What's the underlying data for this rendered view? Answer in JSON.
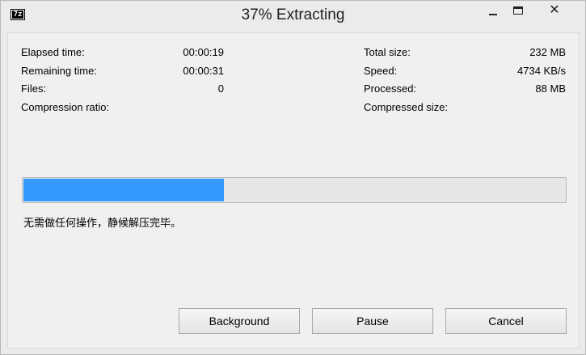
{
  "window": {
    "title": "37% Extracting",
    "app_icon_text": "7z"
  },
  "stats_left": [
    {
      "label": "Elapsed time:",
      "value": "00:00:19"
    },
    {
      "label": "Remaining time:",
      "value": "00:00:31"
    },
    {
      "label": "Files:",
      "value": "0"
    },
    {
      "label": "Compression ratio:",
      "value": ""
    }
  ],
  "stats_right": [
    {
      "label": "Total size:",
      "value": "232 MB"
    },
    {
      "label": "Speed:",
      "value": "4734 KB/s"
    },
    {
      "label": "Processed:",
      "value": "88 MB"
    },
    {
      "label": "Compressed size:",
      "value": ""
    }
  ],
  "progress": {
    "fraction": 0.37,
    "color": "#3399ff"
  },
  "status_message": "无需做任何操作，静候解压完毕。",
  "buttons": {
    "background": "Background",
    "pause": "Pause",
    "cancel": "Cancel"
  },
  "icons": {
    "minimize": "minimize-icon",
    "maximize": "maximize-icon",
    "close": "close-icon"
  }
}
